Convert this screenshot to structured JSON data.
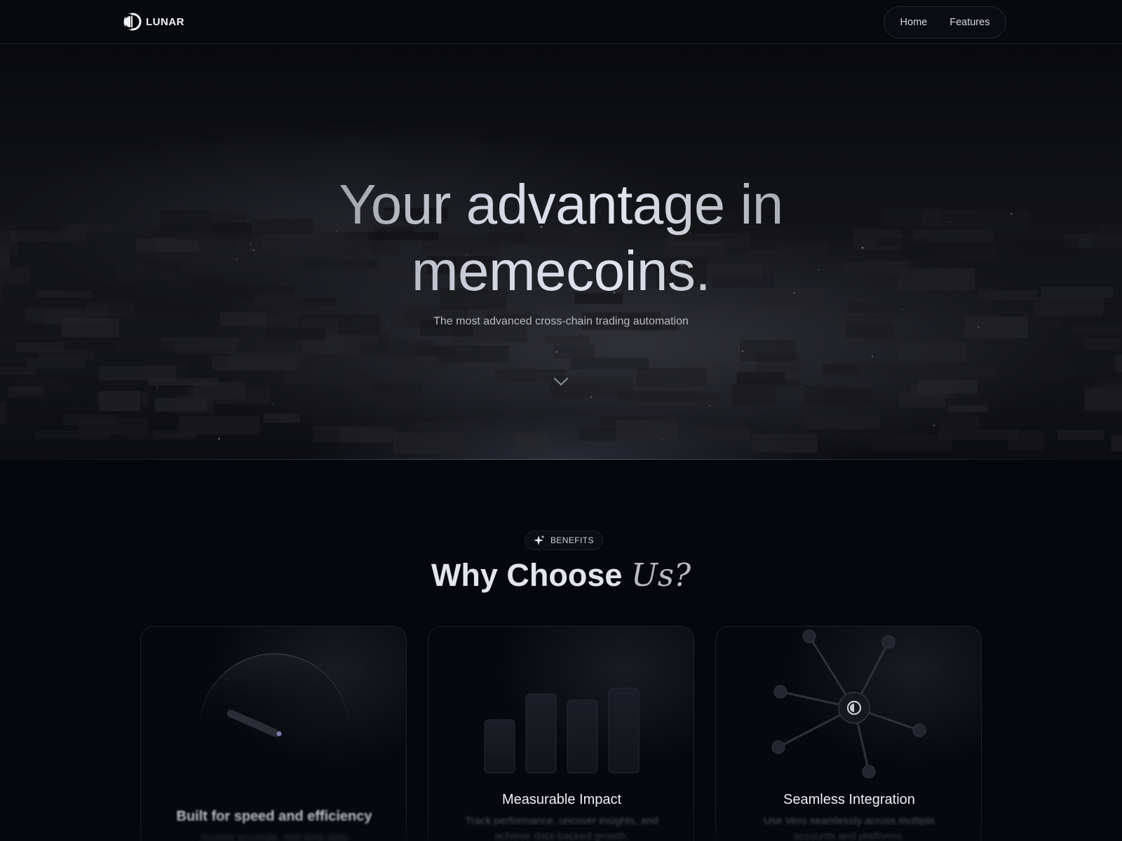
{
  "brand": {
    "name": "LUNAR",
    "logo_icon": "lunar-logo-icon"
  },
  "nav": {
    "items": [
      {
        "label": "Home"
      },
      {
        "label": "Features"
      }
    ]
  },
  "hero": {
    "title_line1": "Your advantage in",
    "title_line2": "memecoins.",
    "subtitle": "The most advanced cross-chain trading automation",
    "scroll_icon": "chevron-down-icon"
  },
  "benefits": {
    "badge_label": "BENEFITS",
    "badge_icon": "sparkle-icon",
    "title_main": "Why Choose ",
    "title_accent": "Us?",
    "cards": [
      {
        "title": "Built for speed and efficiency",
        "description": "Access accurate, real-time data",
        "art_icon": "speedometer-icon"
      },
      {
        "title": "Measurable Impact",
        "description": "Track performance, uncover insights, and achieve data-backed growth.",
        "art_icon": "bar-chart-icon"
      },
      {
        "title": "Seamless Integration",
        "description": "Use Vero seamlessly across multiple accounts and platforms.",
        "art_icon": "network-hub-icon"
      }
    ]
  },
  "colors": {
    "background": "#05070d",
    "nav_background": "#07090d",
    "card_border": "#1e212a",
    "accent_dot": "#7a7fa8",
    "text_primary": "#e6e8ee",
    "text_muted": "#5f636d"
  }
}
